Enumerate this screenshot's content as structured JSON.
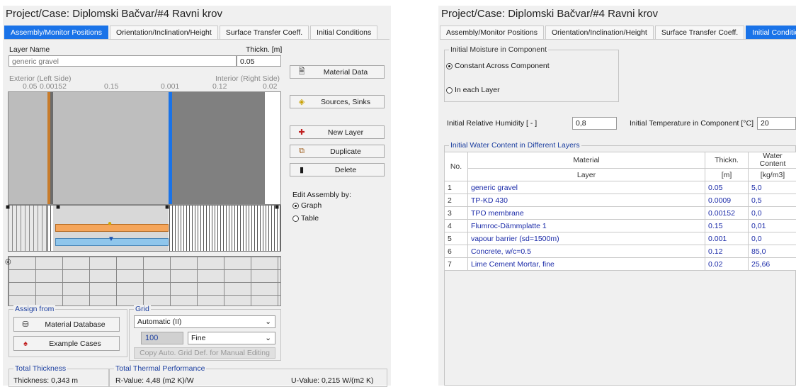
{
  "left": {
    "project_title": "Project/Case:  Diplomski Bačvar/#4 Ravni krov",
    "tabs": [
      "Assembly/Monitor Positions",
      "Orientation/Inclination/Height",
      "Surface Transfer Coeff.",
      "Initial Conditions"
    ],
    "layer_name_label": "Layer Name",
    "layer_name_value": "generic gravel",
    "thickness_label": "Thickn. [m]",
    "thickness_value": "0.05",
    "exterior_label": "Exterior (Left Side)",
    "interior_label": "Interior (Right Side)",
    "scale": {
      "a": "0.05",
      "b": "0.00152",
      "c": "0.15",
      "d": "0.001",
      "e": "0.12",
      "f": "0.02"
    },
    "buttons": {
      "material_data": "Material Data",
      "sources_sinks": "Sources, Sinks",
      "new_layer": "New Layer",
      "duplicate": "Duplicate",
      "delete": "Delete"
    },
    "edit_assembly": {
      "title": "Edit Assembly by:",
      "graph": "Graph",
      "table": "Table"
    },
    "assign_from": {
      "title": "Assign from",
      "material_db": "Material Database",
      "example_cases": "Example Cases"
    },
    "grid": {
      "title": "Grid",
      "mode": "Automatic (II)",
      "count": "100",
      "fineness": "Fine",
      "copy_btn": "Copy Auto. Grid Def. for Manual Editing"
    },
    "total_thickness": {
      "title": "Total Thickness",
      "value": "Thickness: 0,343 m"
    },
    "thermal": {
      "title": "Total Thermal Performance",
      "r_value": "R-Value: 4,48 (m2 K)/W",
      "u_value": "U-Value: 0,215 W/(m2 K)"
    }
  },
  "right": {
    "project_title": "Project/Case:  Diplomski Bačvar/#4 Ravni krov",
    "tabs": [
      "Assembly/Monitor Positions",
      "Orientation/Inclination/Height",
      "Surface Transfer Coeff.",
      "Initial Conditions"
    ],
    "moisture": {
      "title": "Initial Moisture in Component",
      "opt1": "Constant Across Component",
      "opt2": "In each Layer"
    },
    "rh_label": "Initial Relative Humidity [ - ]",
    "rh_value": "0,8",
    "temp_label": "Initial Temperature in Component [°C]",
    "temp_value": "20",
    "water_title": "Initial Water Content in Different Layers",
    "headers": {
      "no": "No.",
      "material": "Material",
      "layer": "Layer",
      "thickn": "Thickn.",
      "unit_m": "[m]",
      "water": "Water",
      "content": "Content",
      "unit_wc": "[kg/m3]"
    },
    "rows": [
      {
        "no": "1",
        "name": "generic gravel",
        "thick": "0.05",
        "wc": "5,0"
      },
      {
        "no": "2",
        "name": "TP-KD 430",
        "thick": "0.0009",
        "wc": "0,5"
      },
      {
        "no": "3",
        "name": "TPO membrane",
        "thick": "0.00152",
        "wc": "0,0"
      },
      {
        "no": "4",
        "name": "Flumroc-Dämmplatte 1",
        "thick": "0.15",
        "wc": "0,01"
      },
      {
        "no": "5",
        "name": "vapour barrier  (sd=1500m)",
        "thick": "0.001",
        "wc": "0,0"
      },
      {
        "no": "6",
        "name": "Concrete, w/c=0.5",
        "thick": "0.12",
        "wc": "85,0"
      },
      {
        "no": "7",
        "name": "Lime Cement Mortar, fine",
        "thick": "0.02",
        "wc": "25,66"
      }
    ]
  },
  "colors": {
    "accent": "#1a73e8",
    "orange": "#f5a55a",
    "lightblue": "#8fc6ec"
  }
}
